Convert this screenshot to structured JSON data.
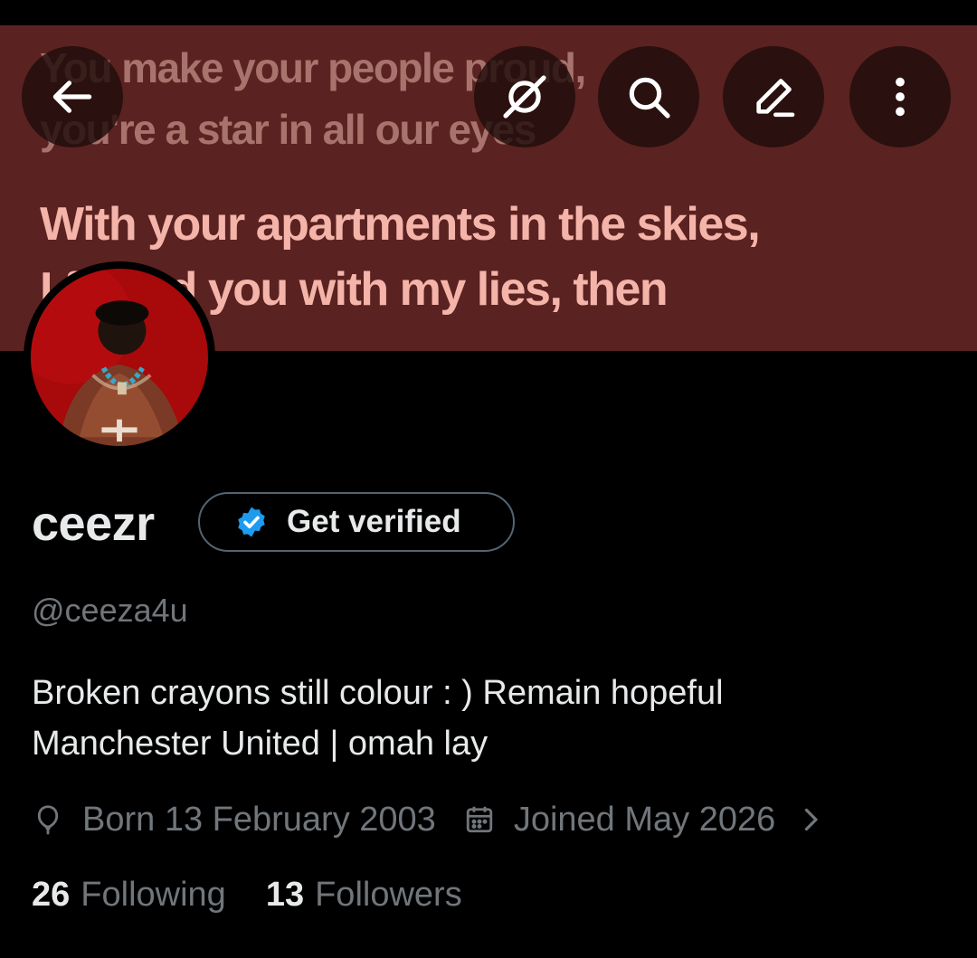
{
  "banner": {
    "lyric_lines": [
      "You make your people proud,",
      "you're a star in all our eyes",
      "With your apartments in the skies,",
      "I fooled you with my lies, then"
    ]
  },
  "header": {
    "buttons": [
      {
        "name": "back",
        "icon": "arrow-left-icon"
      },
      {
        "name": "grok",
        "icon": "grok-icon"
      },
      {
        "name": "search",
        "icon": "search-icon"
      },
      {
        "name": "edit",
        "icon": "pencil-icon"
      },
      {
        "name": "more",
        "icon": "more-vertical-icon"
      }
    ]
  },
  "profile": {
    "display_name": "ceezr",
    "verify_label": "Get verified",
    "handle": "@ceeza4u",
    "bio_lines": [
      "Broken crayons still colour : )  Remain hopeful",
      "Manchester United | omah lay"
    ],
    "born": "Born 13 February 2003",
    "joined": "Joined May 2026",
    "following_count": "26",
    "following_label": "Following",
    "followers_count": "13",
    "followers_label": "Followers"
  },
  "colors": {
    "background": "#000000",
    "banner": "#5a2220",
    "text_primary": "#e7e9ea",
    "text_secondary": "#71767b",
    "verified_badge": "#1d9bf0",
    "button_border": "#536471"
  }
}
